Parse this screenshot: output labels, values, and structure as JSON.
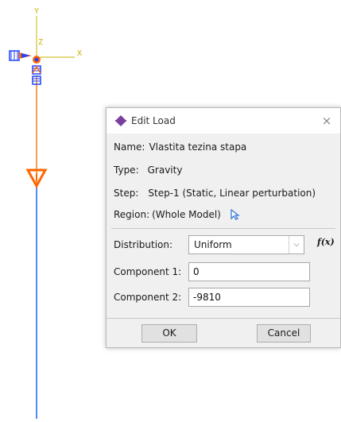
{
  "viewport": {
    "axes": {
      "y_label": "Y",
      "x_label": "X",
      "z_label": "Z"
    },
    "colors": {
      "axis": "#c8b400",
      "beam_upper": "#f5a04a",
      "beam_lower": "#4f8ff5",
      "load_symbol": "#ff6600",
      "bc_symbol": "#2244ff"
    }
  },
  "dialog": {
    "title": "Edit Load",
    "close_glyph": "×",
    "name_label": "Name:",
    "name_value": "Vlastita tezina stapa",
    "type_label": "Type:",
    "type_value": "Gravity",
    "step_label": "Step:",
    "step_value": "Step-1 (Static, Linear perturbation)",
    "region_label": "Region:",
    "region_value": "(Whole Model)",
    "region_icon": "arrow-cursor-icon",
    "distribution_label": "Distribution:",
    "distribution_value": "Uniform",
    "fx_label": "f(x)",
    "component1_label": "Component 1:",
    "component1_value": "0",
    "component2_label": "Component 2:",
    "component2_value": "-9810",
    "ok_label": "OK",
    "cancel_label": "Cancel"
  }
}
